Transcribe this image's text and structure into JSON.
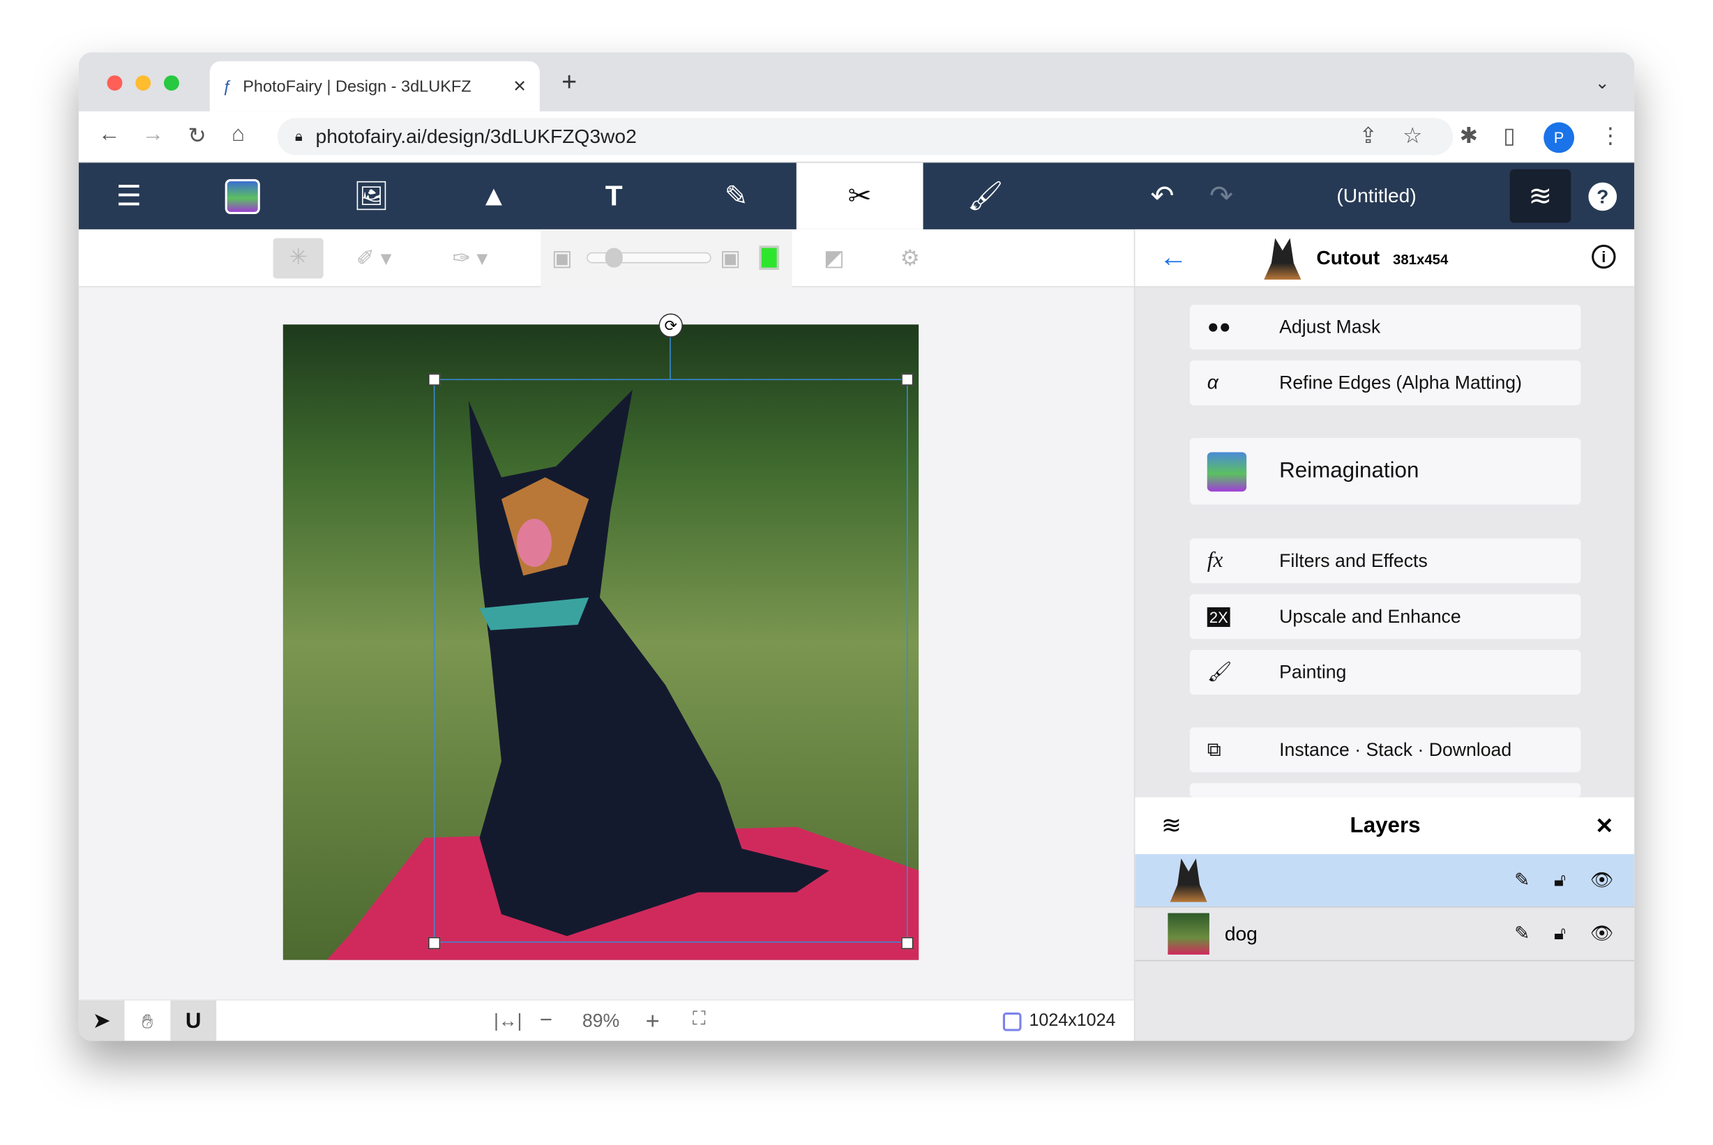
{
  "browser": {
    "tab_title": "PhotoFairy | Design - 3dLUKFZ",
    "url": "photofairy.ai/design/3dLUKFZQ3wo2",
    "profile_initial": "P"
  },
  "app": {
    "document_title": "(Untitled)",
    "accent": "#273a55",
    "active_tool": "cutout"
  },
  "cutout": {
    "title": "Cutout",
    "size": "381x454"
  },
  "menu": [
    {
      "icon": "mask-icon",
      "label": "Adjust Mask"
    },
    {
      "icon": "alpha-icon",
      "glyph": "α",
      "label": "Refine Edges (Alpha Matting)"
    },
    {
      "icon": "reimagination-icon",
      "label": "Reimagination"
    },
    {
      "icon": "fx-icon",
      "glyph": "fx",
      "label": "Filters and Effects"
    },
    {
      "icon": "upscale-icon",
      "glyph": "2X",
      "label": "Upscale and Enhance"
    },
    {
      "icon": "brush-icon",
      "label": "Painting"
    },
    {
      "icon": "instance-icon",
      "label": "Instance · Stack · Download"
    }
  ],
  "layers": {
    "title": "Layers",
    "items": [
      {
        "name": "",
        "selected": true
      },
      {
        "name": "dog",
        "selected": false
      }
    ]
  },
  "bottom": {
    "zoom": "89%",
    "canvas_size": "1024x1024"
  }
}
